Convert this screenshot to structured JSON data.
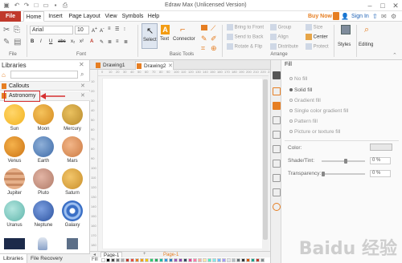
{
  "titlebar": {
    "title": "Edraw Max (Unlicensed Version)"
  },
  "menubar": {
    "tabs": [
      "File",
      "Home",
      "Insert",
      "Page Layout",
      "View",
      "Symbols",
      "Help"
    ],
    "buy_now": "Buy Now",
    "sign_in": "Sign In"
  },
  "ribbon": {
    "groups": {
      "file": "File",
      "font": "Font",
      "basic_tools": "Basic Tools",
      "arrange": "Arrange"
    },
    "font_name": "Arial",
    "font_size": "10",
    "tools": {
      "select": "Select",
      "text": "Text",
      "connector": "Connector"
    },
    "arrange": {
      "bring_to_front": "Bring to Front",
      "send_to_back": "Send to Back",
      "rotate_flip": "Rotate & Flip",
      "group": "Group",
      "align": "Align",
      "distribute": "Distribute",
      "size": "Size",
      "center": "Center",
      "protect": "Protect"
    },
    "styles": "Styles",
    "editing": "Editing"
  },
  "libraries": {
    "title": "Libraries",
    "sections": [
      "Callouts",
      "Astronomy"
    ],
    "symbols": [
      "Sun",
      "Moon",
      "Mercury",
      "Venus",
      "Earth",
      "Mars",
      "Jupiter",
      "Pluto",
      "Saturn",
      "Uranus",
      "Neptune",
      "Galaxy"
    ],
    "bottom_tabs": [
      "Libraries",
      "File Recovery"
    ]
  },
  "canvas": {
    "tabs": [
      "Drawing1",
      "Drawing2"
    ],
    "ruler_ticks": [
      "0",
      "10",
      "20",
      "30",
      "40",
      "50",
      "60",
      "70",
      "80",
      "90",
      "100",
      "110",
      "120",
      "130",
      "140",
      "150",
      "160",
      "170",
      "180",
      "190",
      "200",
      "210",
      "220",
      "230"
    ],
    "ruler_left_ticks": [
      "10",
      "20",
      "30",
      "40",
      "50",
      "60",
      "70",
      "80",
      "90",
      "100",
      "110",
      "120",
      "130",
      "140",
      "150",
      "160",
      "170",
      "180"
    ],
    "page_tabs": [
      "Page-1",
      "Page-1"
    ],
    "fill_label": "Fill"
  },
  "fill_panel": {
    "title": "Fill",
    "options": [
      "No fill",
      "Solid fill",
      "Gradient fill",
      "Single color gradient fill",
      "Pattern fill",
      "Picture or texture fill"
    ],
    "selected": "Solid fill",
    "color_label": "Color:",
    "shade_label": "Shade/Tint:",
    "shade_value": "0 %",
    "transparency_label": "Transparency:",
    "transparency_value": "0 %"
  },
  "watermark": "Baidu 经验",
  "colors": {
    "accent_red": "#c0392b",
    "annotation_red": "#d63031",
    "sun": "#f2c23a",
    "moon": "#e0a83a",
    "mercury": "#d4a640",
    "venus": "#e79a2e",
    "earth": "#5d84b8",
    "mars": "#e39a63",
    "jupiter": "#d89c74",
    "pluto": "#c99a8a",
    "saturn": "#e0ad4a",
    "uranus": "#8ad0c8",
    "neptune": "#4a74c0",
    "galaxy": "#3a6fc6"
  }
}
